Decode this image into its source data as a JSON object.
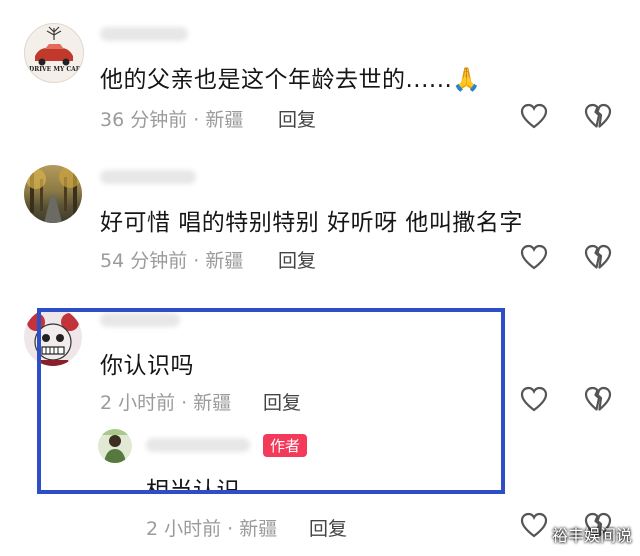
{
  "comments": [
    {
      "text": "他的父亲也是这个年龄去世的......🙏",
      "meta": "36 分钟前 · 新疆",
      "reply_label": "回复",
      "avatar_caption": "DRIVE MY CAR"
    },
    {
      "text": "好可惜 唱的特别特别 好听呀 他叫撒名字",
      "meta": "54 分钟前 · 新疆",
      "reply_label": "回复"
    },
    {
      "text": "你认识吗",
      "meta": "2 小时前 · 新疆",
      "reply_label": "回复",
      "reply": {
        "badge": "作者",
        "text": "相当认识",
        "meta": "2 小时前 · 新疆",
        "reply_label": "回复"
      }
    }
  ],
  "icons": {
    "like": "heart-outline-icon",
    "dislike": "broken-heart-icon"
  },
  "colors": {
    "highlight": "#2e4ec8",
    "author_badge": "#f33a5b",
    "meta": "#9b9b9b"
  },
  "watermark": "裕丰娱间说"
}
